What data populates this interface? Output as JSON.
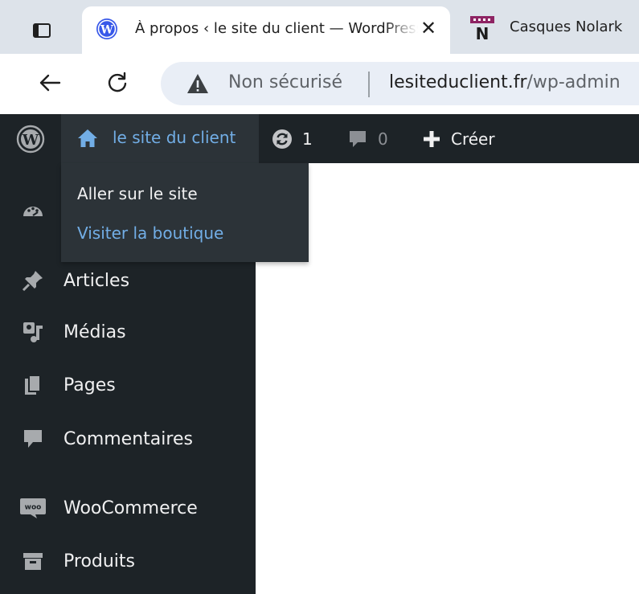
{
  "browser": {
    "tabs": [
      {
        "title": "À propos ‹ le site du client — WordPress",
        "active": true,
        "favicon": "wordpress-icon"
      },
      {
        "title": "Casques Nolark",
        "active": false,
        "favicon": "nolark-icon"
      }
    ],
    "close_glyph": "✕",
    "address": {
      "security": "Non sécurisé",
      "domain": "lesiteduclient.fr",
      "path": "/wp-admin"
    }
  },
  "adminbar": {
    "site_name": "le site du client",
    "updates_count": "1",
    "comments_count": "0",
    "new_label": "Créer"
  },
  "dropdown": {
    "items": [
      "Aller sur le site",
      "Visiter la boutique"
    ]
  },
  "sidebar": {
    "items": [
      {
        "label": "Articles",
        "icon": "pin-icon"
      },
      {
        "label": "Médias",
        "icon": "media-icon"
      },
      {
        "label": "Pages",
        "icon": "pages-icon"
      },
      {
        "label": "Commentaires",
        "icon": "comment-icon"
      },
      {
        "label": "WooCommerce",
        "icon": "woo-icon"
      },
      {
        "label": "Produits",
        "icon": "archive-icon"
      }
    ]
  },
  "colors": {
    "adminbar": "#1d2327",
    "submenu": "#2c3338",
    "link_blue": "#72aee6",
    "text_light": "#f0f0f1"
  }
}
